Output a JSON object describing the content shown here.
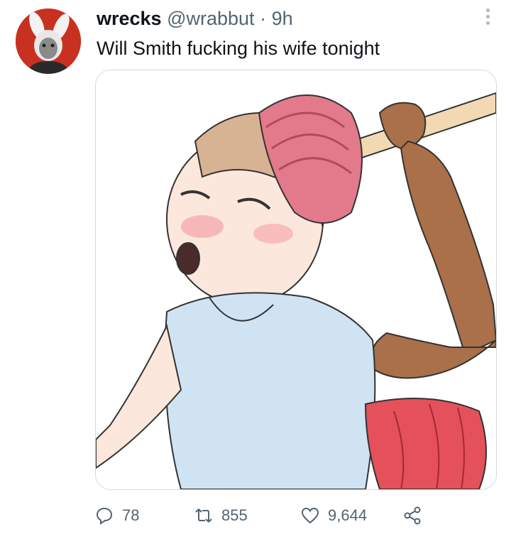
{
  "tweet": {
    "display_name": "wrecks",
    "handle": "@wrabbut",
    "separator": "·",
    "time": "9h",
    "text": "Will Smith fucking his wife tonight"
  },
  "actions": {
    "reply_count": "78",
    "retweet_count": "855",
    "like_count": "9,644"
  },
  "icons": {
    "reply": "reply-icon",
    "retweet": "retweet-icon",
    "like": "like-icon",
    "share": "share-icon",
    "more": "more-options-icon"
  },
  "colors": {
    "text_primary": "#0f1419",
    "text_secondary": "#536471",
    "avatar_bg": "#c8311f",
    "media_border": "#cfd9de"
  }
}
